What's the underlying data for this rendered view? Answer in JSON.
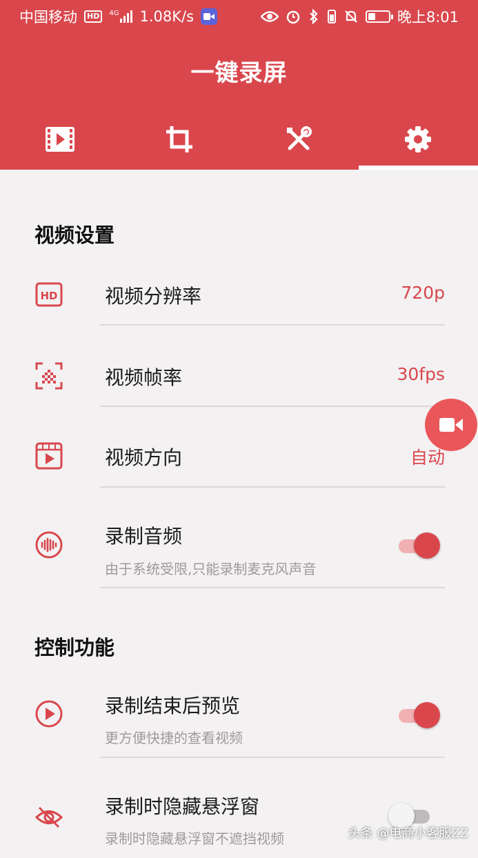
{
  "status_bar": {
    "carrier": "中国移动",
    "hd_badge": "HD",
    "network": "4G",
    "speed": "1.08K/s",
    "time": "晚上8:01",
    "battery_level": 0.35,
    "icons": [
      "hd-icon",
      "signal-icon",
      "app-badge-icon",
      "eye-icon",
      "alarm-icon",
      "bluetooth-icon",
      "vibrate-icon",
      "mute-icon",
      "battery-icon"
    ]
  },
  "header": {
    "title": "一键录屏",
    "tabs": [
      {
        "icon": "video-list-icon"
      },
      {
        "icon": "crop-icon"
      },
      {
        "icon": "tools-icon"
      },
      {
        "icon": "settings-gear-icon",
        "active": true
      }
    ]
  },
  "video_settings": {
    "section_title": "视频设置",
    "resolution": {
      "label": "视频分辨率",
      "value": "720p",
      "icon": "hd-quality-icon"
    },
    "frame_rate": {
      "label": "视频帧率",
      "value": "30fps",
      "icon": "frame-rate-icon"
    },
    "orientation": {
      "label": "视频方向",
      "value": "自动",
      "icon": "video-frame-icon"
    },
    "record_audio": {
      "label": "录制音频",
      "sub": "由于系统受限,只能录制麦克风声音",
      "enabled": true,
      "icon": "audio-wave-icon"
    }
  },
  "control_settings": {
    "section_title": "控制功能",
    "preview_after": {
      "label": "录制结束后预览",
      "sub": "更方便快捷的查看视频",
      "enabled": true,
      "icon": "play-circle-icon"
    },
    "hide_float": {
      "label": "录制时隐藏悬浮窗",
      "sub": "录制时隐藏悬浮窗不遮挡视频",
      "enabled": false,
      "icon": "eye-off-icon"
    }
  },
  "fab": {
    "icon": "video-camera-icon"
  },
  "watermark": "头条 @电商小客服ZZ",
  "colors": {
    "accent": "#d9474d",
    "background": "#f3f1f2",
    "subtext": "#9e9a9b"
  }
}
